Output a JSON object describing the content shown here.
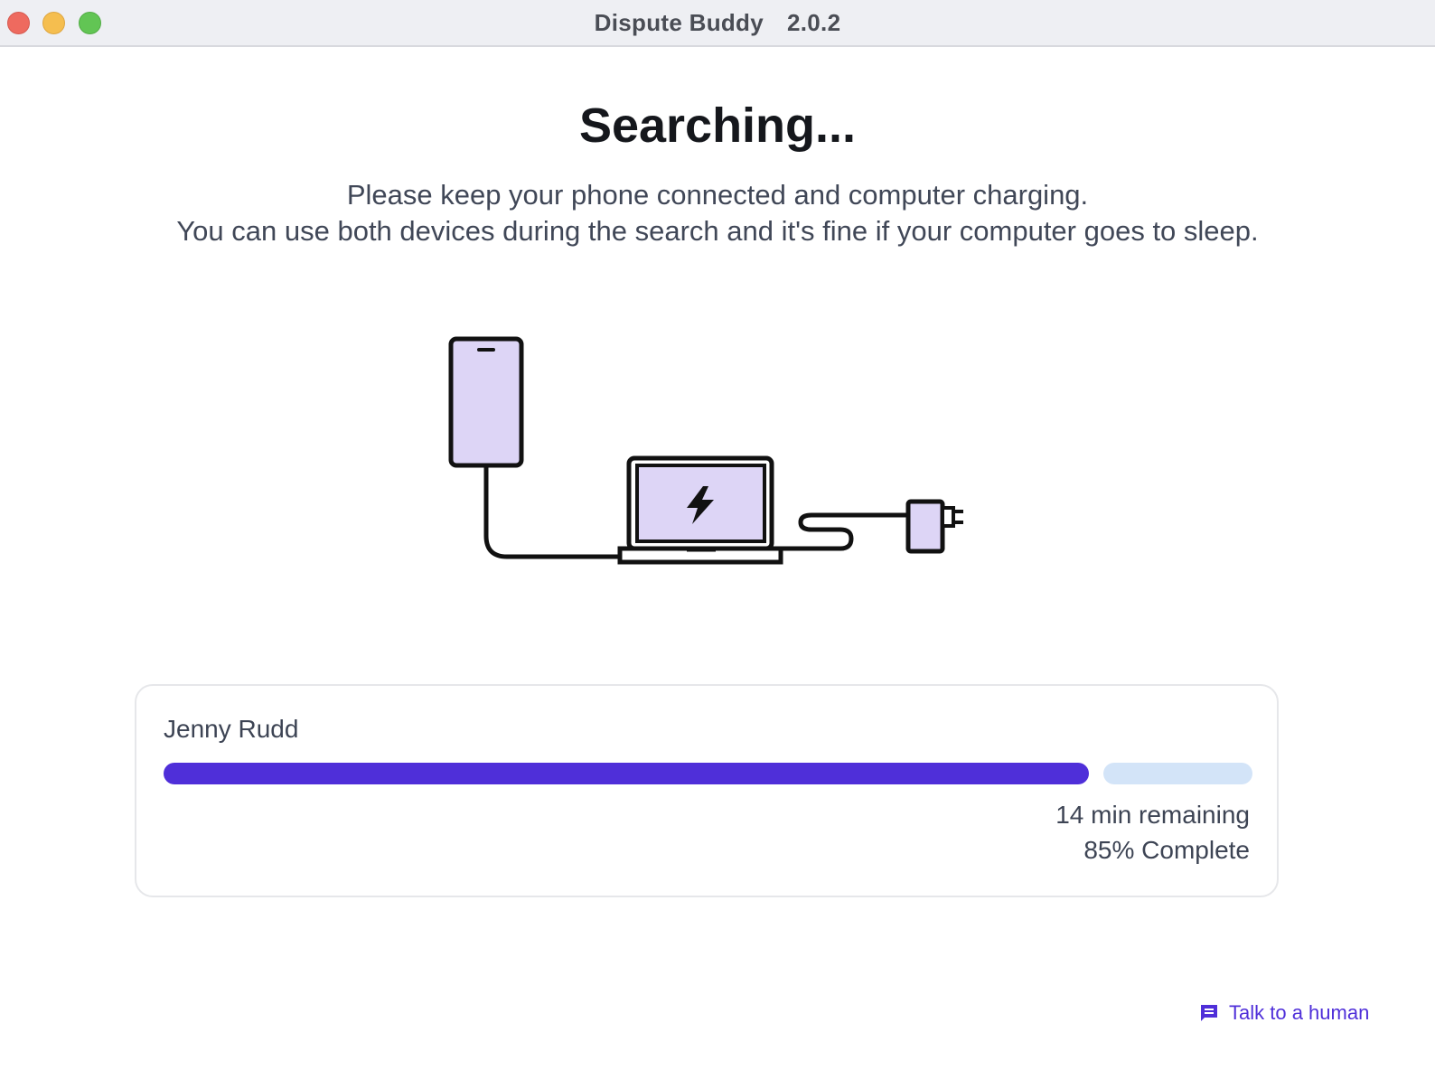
{
  "window": {
    "title": "Dispute Buddy",
    "version": "2.0.2"
  },
  "main": {
    "heading": "Searching...",
    "line1": "Please keep your phone connected and computer charging.",
    "line2": "You can use both devices during the search and it's fine if your computer goes to sleep."
  },
  "progress_card": {
    "name": "Jenny Rudd",
    "percent_complete": 85,
    "remaining_text": "14 min remaining",
    "complete_text": "85% Complete"
  },
  "help": {
    "label": "Talk to a human",
    "icon": "chat-icon"
  },
  "colors": {
    "accent": "#4f2fd9",
    "progress_track": "#d3e4f8",
    "device_fill": "#ddd5f6"
  }
}
